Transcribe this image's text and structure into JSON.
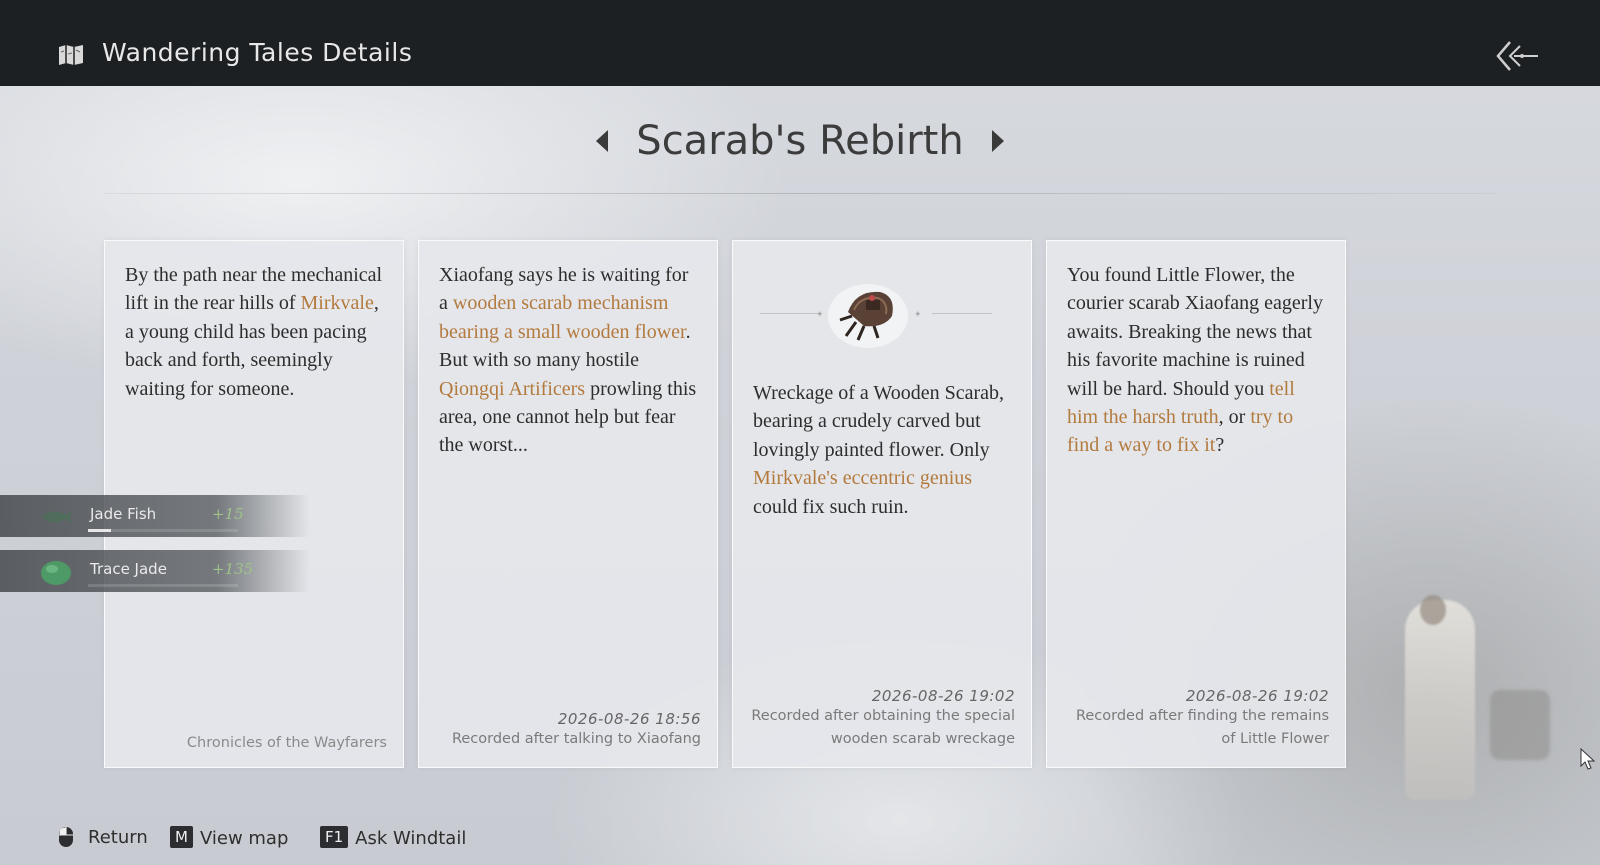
{
  "header": {
    "title": "Wandering Tales Details",
    "map_icon": "folded-map-icon",
    "back_icon": "double-chevron-back-icon"
  },
  "quest": {
    "title": "Scarab's Rebirth",
    "prev_icon": "triangle-left-icon",
    "next_icon": "triangle-right-icon"
  },
  "cards": [
    {
      "segments": [
        {
          "text": "By the path near the mechanical lift in the rear hills of ",
          "highlight": false
        },
        {
          "text": "Mirkvale",
          "highlight": true
        },
        {
          "text": ", a young child has been pacing back and forth, seemingly waiting for someone.",
          "highlight": false
        }
      ],
      "origin": "Chronicles of the Wayfarers"
    },
    {
      "segments": [
        {
          "text": "Xiaofang says he is waiting for a ",
          "highlight": false
        },
        {
          "text": "wooden scarab mechanism bearing a small wooden flower",
          "highlight": true
        },
        {
          "text": ". But with so many hostile ",
          "highlight": false
        },
        {
          "text": "Qiongqi Artificers",
          "highlight": true
        },
        {
          "text": " prowling this area, one cannot help but fear the worst...",
          "highlight": false
        }
      ],
      "date": "2026-08-26 18:56",
      "note": "Recorded after talking to Xiaofang"
    },
    {
      "item_icon": "wooden-scarab-wreckage-icon",
      "segments": [
        {
          "text": "Wreckage of a Wooden Scarab, bearing a crudely carved but lovingly painted flower. Only ",
          "highlight": false
        },
        {
          "text": "Mirkvale's eccentric genius",
          "highlight": true
        },
        {
          "text": " could fix such ruin.",
          "highlight": false
        }
      ],
      "date": "2026-08-26 19:02",
      "note": "Recorded after obtaining the special wooden scarab wreckage"
    },
    {
      "segments": [
        {
          "text": "You found Little Flower, the courier scarab Xiaofang eagerly awaits. Breaking the news that his favorite machine is ruined will be hard. Should you ",
          "highlight": false
        },
        {
          "text": "tell him the harsh truth",
          "highlight": true
        },
        {
          "text": ", or ",
          "highlight": false
        },
        {
          "text": "try to find a way to fix it",
          "highlight": true
        },
        {
          "text": "?",
          "highlight": false
        }
      ],
      "date": "2026-08-26 19:02",
      "note": "Recorded after finding the remains of Little Flower"
    }
  ],
  "pickups": [
    {
      "name": "Jade Fish",
      "amount": "+15",
      "icon": "jade-fish-icon",
      "progress": 0.15
    },
    {
      "name": "Trace Jade",
      "amount": "+135",
      "icon": "trace-jade-icon",
      "progress": 0
    }
  ],
  "hints": [
    {
      "key": "",
      "icon": "mouse-icon",
      "label": "Return"
    },
    {
      "key": "M",
      "label": "View map"
    },
    {
      "key": "F1",
      "label": "Ask Windtail"
    }
  ],
  "colors": {
    "highlight": "#b37a3e",
    "topbar": "#1d2023",
    "pickup_amount": "#9ec28a"
  }
}
